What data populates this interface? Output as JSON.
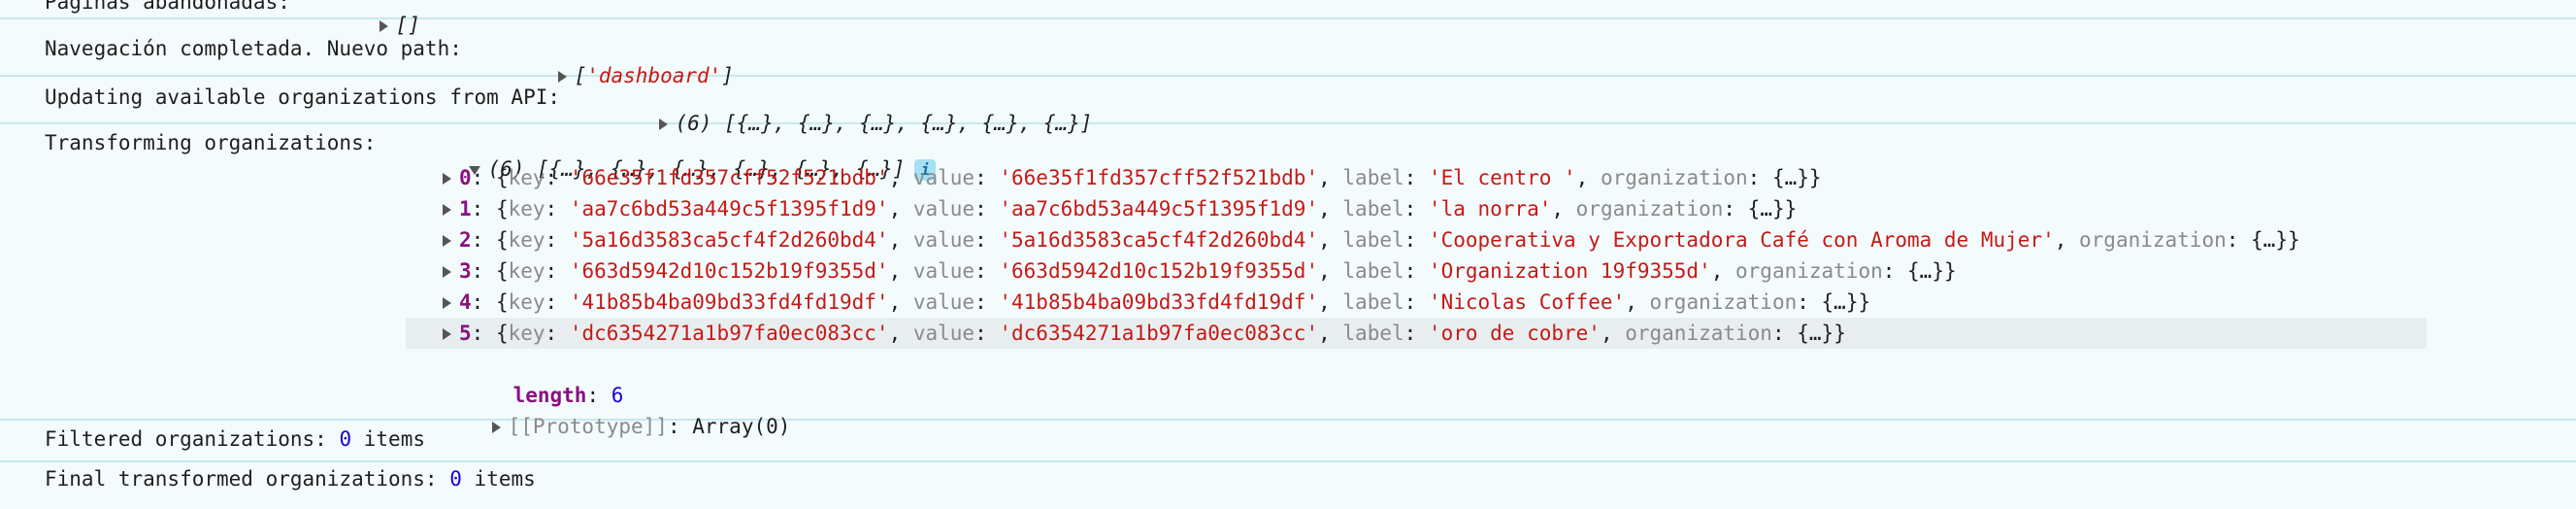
{
  "console": {
    "rows": [
      {
        "label": "Páginas abandonadas:",
        "value": "[]"
      },
      {
        "label": "Navegación completada. Nuevo path:",
        "value_open": "[",
        "value_str": "'dashboard'",
        "value_close": "]"
      },
      {
        "label": "Updating available organizations from API:",
        "value": "(6) [{…}, {…}, {…}, {…}, {…}, {…}]"
      },
      {
        "label": "Transforming organizations:",
        "value": "(6) [{…}, {…}, {…}, {…}, {…}, {…}]",
        "info_icon": "i"
      }
    ],
    "items": [
      {
        "index": "0",
        "key": "'66e35f1fd357cff52f521bdb'",
        "value": "'66e35f1fd357cff52f521bdb'",
        "label": "'El centro '"
      },
      {
        "index": "1",
        "key": "'aa7c6bd53a449c5f1395f1d9'",
        "value": "'aa7c6bd53a449c5f1395f1d9'",
        "label": "'la norra'"
      },
      {
        "index": "2",
        "key": "'5a16d3583ca5cf4f2d260bd4'",
        "value": "'5a16d3583ca5cf4f2d260bd4'",
        "label": "'Cooperativa y Exportadora Café con Aroma de Mujer'"
      },
      {
        "index": "3",
        "key": "'663d5942d10c152b19f9355d'",
        "value": "'663d5942d10c152b19f9355d'",
        "label": "'Organization 19f9355d'"
      },
      {
        "index": "4",
        "key": "'41b85b4ba09bd33fd4fd19df'",
        "value": "'41b85b4ba09bd33fd4fd19df'",
        "label": "'Nicolas Coffee'"
      },
      {
        "index": "5",
        "key": "'dc6354271a1b97fa0ec083cc'",
        "value": "'dc6354271a1b97fa0ec083cc'",
        "label": "'oro de cobre'"
      }
    ],
    "prop_names": {
      "key": "key",
      "value": "value",
      "label": "label",
      "organization": "organization",
      "collapsed_obj": "{…}"
    },
    "length_label": "length",
    "length_value": "6",
    "prototype_label": "[[Prototype]]",
    "prototype_value": "Array(0)",
    "filtered": {
      "label": "Filtered organizations:",
      "count": "0",
      "unit": "items"
    },
    "final": {
      "label": "Final transformed organizations:",
      "count": "0",
      "unit": "items"
    }
  }
}
